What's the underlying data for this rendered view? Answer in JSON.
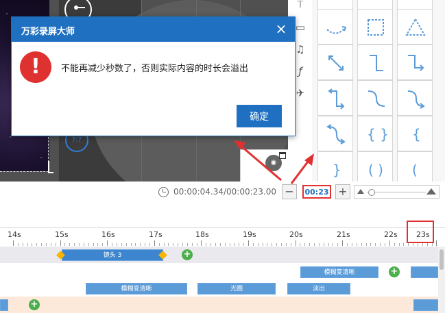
{
  "dialog": {
    "title": "万彩录屏大师",
    "close_symbol": "×",
    "message": "不能再减少秒数了，否则实际内容的时长会溢出",
    "confirm_label": "确定",
    "warning_symbol": "!"
  },
  "preview": {
    "badge_text": "?:?"
  },
  "time_bar": {
    "position_text": "00:00:04.34/00:00:23.00",
    "minus_symbol": "−",
    "duration_value": "00:23",
    "plus_symbol": "+"
  },
  "ruler": {
    "labels": [
      "14s",
      "15s",
      "16s",
      "17s",
      "18s",
      "19s",
      "20s",
      "21s",
      "22s",
      "23s"
    ]
  },
  "tracks": {
    "camera_clip_label": "镜头 3",
    "blur_clear_label_1": "模糊变清晰",
    "blur_clear_label_2": "模糊变清晰",
    "halo_label": "光圈",
    "fade_out_label": "淡出",
    "add_symbol": "+"
  },
  "side_icons": [
    "pin-icon",
    "folder-icon",
    "music-icon",
    "function-icon",
    "airplane-icon"
  ],
  "colors": {
    "accent": "#1f70c1",
    "alert": "#e03131",
    "clip": "#3d86cf",
    "keyframe": "#f7b500",
    "add": "#4cae4c"
  }
}
